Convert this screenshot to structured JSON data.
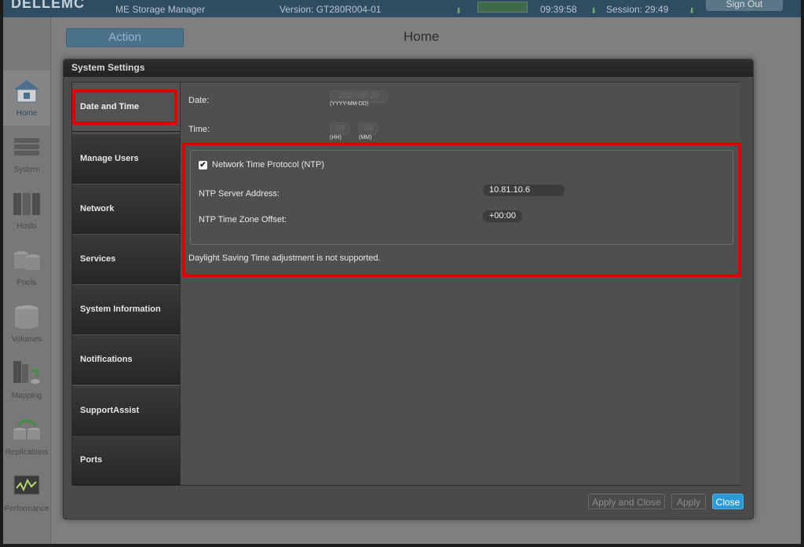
{
  "topbar": {
    "logo": "DELLEMC",
    "app_name": "ME Storage Manager",
    "version": "Version: GT280R004-01",
    "time": "09:39:58",
    "session": "Session: 29:49",
    "sign_out": "Sign Out"
  },
  "header": {
    "action_label": "Action",
    "page_title": "Home"
  },
  "nav": [
    {
      "label": "Home",
      "icon": "home-icon"
    },
    {
      "label": "System",
      "icon": "system-icon"
    },
    {
      "label": "Hosts",
      "icon": "hosts-icon"
    },
    {
      "label": "Pools",
      "icon": "pools-icon"
    },
    {
      "label": "Volumes",
      "icon": "volumes-icon"
    },
    {
      "label": "Mapping",
      "icon": "mapping-icon"
    },
    {
      "label": "Replications",
      "icon": "replications-icon"
    },
    {
      "label": "Performance",
      "icon": "performance-icon"
    }
  ],
  "modal": {
    "title": "System Settings",
    "tabs": [
      {
        "label": "Date and Time"
      },
      {
        "label": "Manage Users"
      },
      {
        "label": "Network"
      },
      {
        "label": "Services"
      },
      {
        "label": "System Information"
      },
      {
        "label": "Notifications"
      },
      {
        "label": "SupportAssist"
      },
      {
        "label": "Ports"
      }
    ],
    "date_label": "Date:",
    "date_value": "2020-08-20",
    "date_hint": "(YYYY-MM-DD)",
    "time_label": "Time:",
    "hour_value": "09",
    "minute_value": "39",
    "hour_hint": "(HH)",
    "minute_hint": "(MM)",
    "ntp_checkbox_label": "Network Time Protocol (NTP)",
    "ntp_checked": true,
    "ntp_server_label": "NTP Server Address:",
    "ntp_server_value": "10.81.10.6",
    "ntp_offset_label": "NTP Time Zone Offset:",
    "ntp_offset_value": "+00:00",
    "dst_note": "Daylight Saving Time adjustment is not supported.",
    "buttons": {
      "apply_and_close": "Apply and Close",
      "apply": "Apply",
      "close": "Close"
    }
  },
  "colors": {
    "close_button": "#2b9bd8",
    "highlight": "#e00000",
    "topbar": "#2f4d62"
  }
}
